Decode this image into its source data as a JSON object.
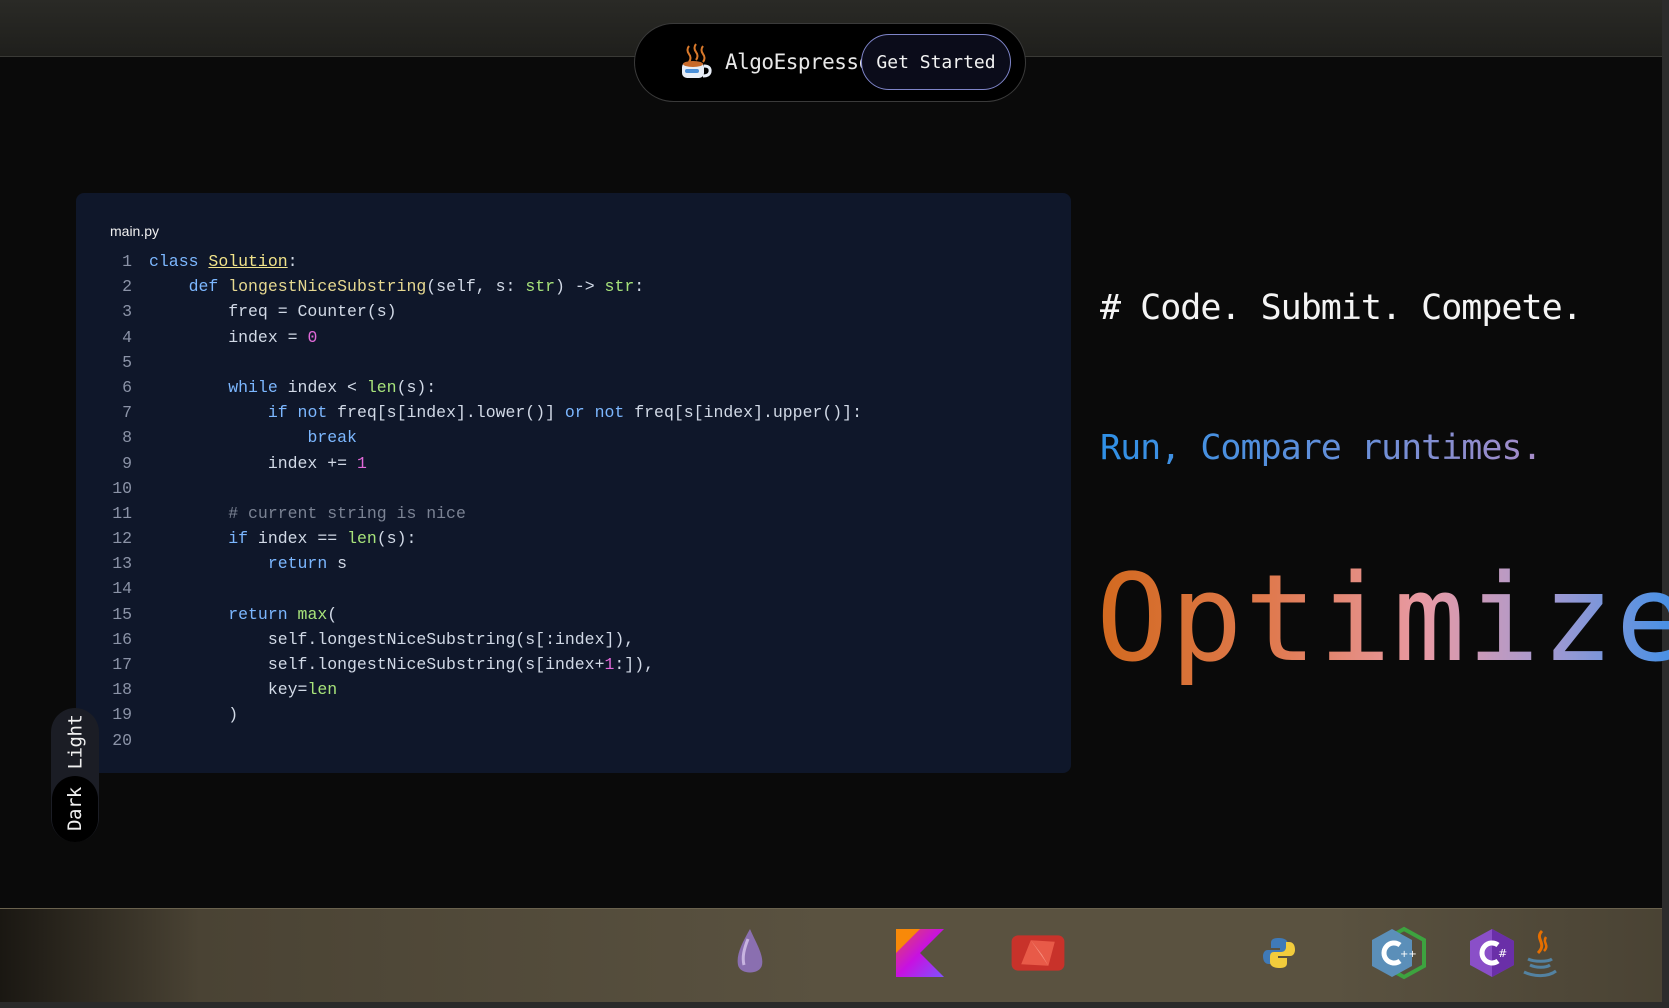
{
  "brand": {
    "name": "AlgoEspresso",
    "logo_icon": "coffee-cup-icon"
  },
  "nav": {
    "cta_label": "Get Started"
  },
  "editor": {
    "filename": "main.py",
    "line_numbers": [
      "1",
      "2",
      "3",
      "4",
      "5",
      "6",
      "7",
      "8",
      "9",
      "10",
      "11",
      "12",
      "13",
      "14",
      "15",
      "16",
      "17",
      "18",
      "19",
      "20"
    ],
    "lines": [
      "class Solution:",
      "    def longestNiceSubstring(self, s: str) -> str:",
      "        freq = Counter(s)",
      "        index = 0",
      "",
      "        while index < len(s):",
      "            if not freq[s[index].lower()] or not freq[s[index].upper()]:",
      "                break",
      "            index += 1",
      "",
      "        # current string is nice",
      "        if index == len(s):",
      "            return s",
      "",
      "        return max(",
      "            self.longestNiceSubstring(s[:index]),",
      "            self.longestNiceSubstring(s[index+1:]),",
      "            key=len",
      "        )",
      ""
    ]
  },
  "theme_toggle": {
    "light_label": "Light",
    "dark_label": "Dark",
    "selected": "Dark"
  },
  "hero": {
    "tagline": "# Code. Submit. Compete.",
    "subline": "Run, Compare runtimes.",
    "headline": "Optimize"
  },
  "colors": {
    "page_bg": "#0a0a0a",
    "editor_bg": "#0f172a",
    "cta_border": "#7e84c8",
    "headline_gradient": [
      "#d2691e",
      "#e89aa4",
      "#a89ad0",
      "#3a8fe8"
    ]
  },
  "language_dock": {
    "icons": [
      "elixir-icon",
      "kotlin-icon",
      "ruby-icon",
      "python-icon",
      "cpp-icon",
      "csharp-icon",
      "java-icon"
    ]
  }
}
